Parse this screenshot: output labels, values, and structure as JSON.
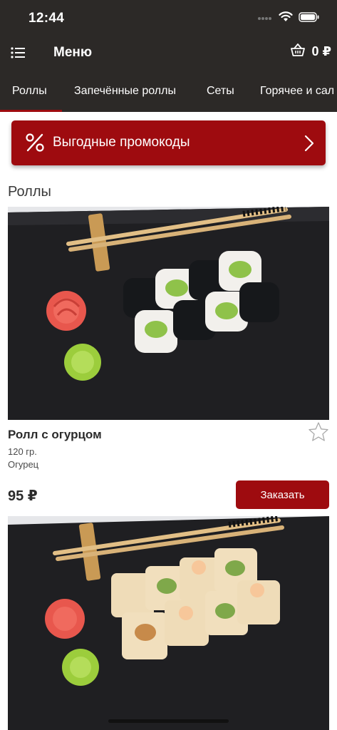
{
  "status_bar": {
    "time": "12:44"
  },
  "nav": {
    "title": "Меню",
    "cart_total": "0 ₽"
  },
  "tabs": [
    {
      "label": "Роллы"
    },
    {
      "label": "Запечённые роллы"
    },
    {
      "label": "Сеты"
    },
    {
      "label": "Горячее и сал"
    }
  ],
  "promo": {
    "label": "Выгодные промокоды"
  },
  "section": {
    "title": "Роллы"
  },
  "products": [
    {
      "name": "Ролл с огурцом",
      "weight": "120 гр.",
      "description": "Огурец",
      "price": "95 ₽",
      "order_label": "Заказать"
    }
  ],
  "colors": {
    "header_bg": "#2c2927",
    "accent": "#9e0b0f"
  }
}
